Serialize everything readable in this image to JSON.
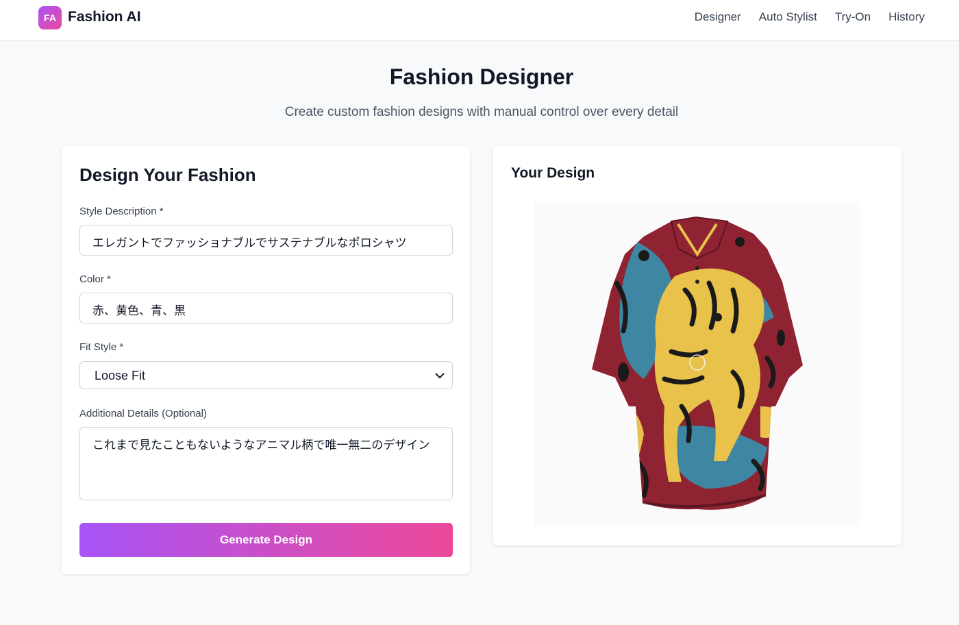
{
  "header": {
    "logo_text": "FA",
    "brand": "Fashion AI",
    "nav": [
      "Designer",
      "Auto Stylist",
      "Try-On",
      "History"
    ]
  },
  "page": {
    "title": "Fashion Designer",
    "subtitle": "Create custom fashion designs with manual control over every detail"
  },
  "form": {
    "heading": "Design Your Fashion",
    "style_label": "Style Description *",
    "style_value": "エレガントでファッショナブルでサステナブルなポロシャツ",
    "color_label": "Color *",
    "color_value": "赤、黄色、青、黒",
    "fit_label": "Fit Style *",
    "fit_value": "Loose Fit",
    "details_label": "Additional Details (Optional)",
    "details_value": "これまで見たこともないようなアニマル柄で唯一無二のデザイン",
    "button": "Generate Design"
  },
  "result": {
    "heading": "Your Design",
    "image_subject": "polo-shirt-animal-print",
    "palette": {
      "red": "#8f2332",
      "yellow": "#e8c24a",
      "blue": "#3f86a3",
      "black": "#1a1a1a"
    }
  }
}
